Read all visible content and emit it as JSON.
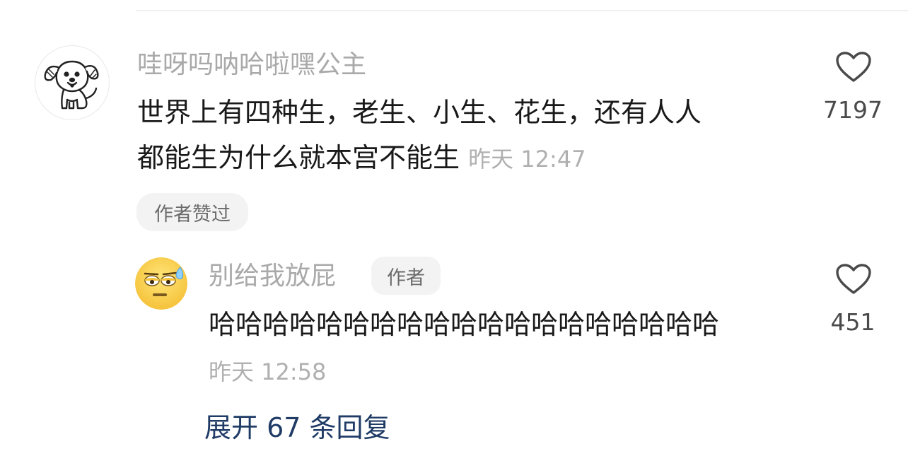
{
  "comment": {
    "username": "哇呀吗呐哈啦嘿公主",
    "text_line1": "世界上有四种生，老生、小生、花生，还有人人",
    "text_line2": "都能生为什么就本宫不能生",
    "timestamp": "昨天 12:47",
    "tag": "作者赞过",
    "like_count": "7197",
    "avatar_icon": "dog-avatar-icon"
  },
  "reply": {
    "username": "别给我放屁",
    "author_badge": "作者",
    "text": "哈哈哈哈哈哈哈哈哈哈哈哈哈哈哈哈哈哈哈",
    "timestamp": "昨天 12:58",
    "like_count": "451",
    "avatar_icon": "sweating-emoji-avatar-icon"
  },
  "expand_replies": "展开 67 条回复",
  "colors": {
    "username": "#a9a9a9",
    "body_text": "#191919",
    "timestamp": "#b0b0b0",
    "link": "#1f3b66",
    "tag_bg": "#f3f3f3"
  }
}
